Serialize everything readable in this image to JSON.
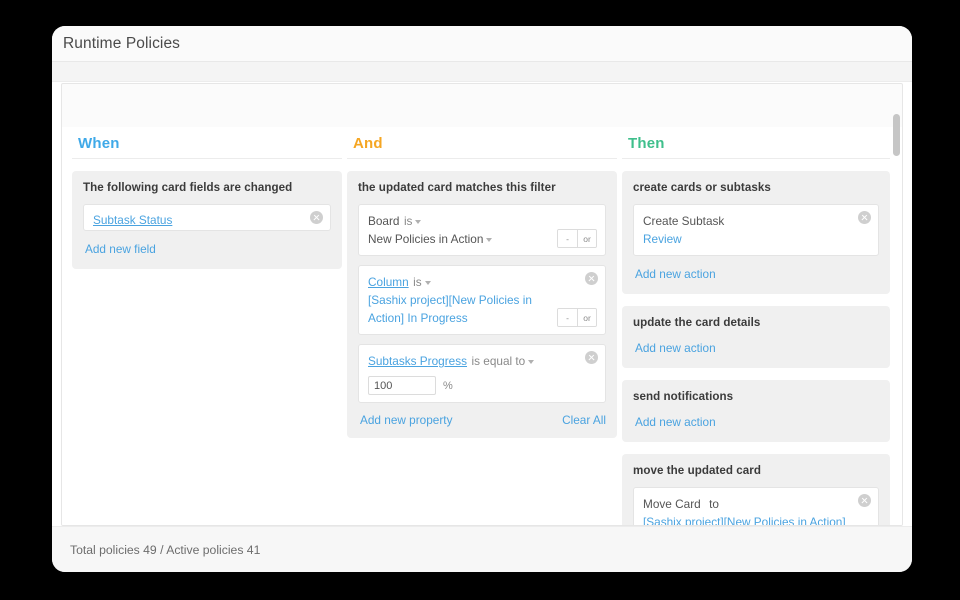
{
  "window": {
    "title": "Runtime Policies"
  },
  "colors": {
    "when": "#3fa9e8",
    "and": "#f5a623",
    "then": "#3fbf8c",
    "link": "#4aa3e0",
    "muted": "#8a8a8a"
  },
  "columns": {
    "when": {
      "header": "When",
      "groups": [
        {
          "title": "The following card fields are changed",
          "field_value": "Subtask Status",
          "add_label": "Add new field"
        }
      ]
    },
    "and": {
      "header": "And",
      "group_title": "the updated card matches this filter",
      "filters": [
        {
          "property": "Board",
          "property_is_link": false,
          "operator": "is",
          "value": "New Policies in Action",
          "value_has_caret": true,
          "has_close": false,
          "oper_minus": "-",
          "oper_or": "or"
        },
        {
          "property": "Column",
          "property_is_link": true,
          "operator": "is",
          "value": "[Sashix project][New Policies in Action] In Progress",
          "value_has_caret": false,
          "has_close": true,
          "oper_minus": "-",
          "oper_or": "or"
        },
        {
          "property": "Subtasks Progress",
          "property_is_link": true,
          "operator": "is equal to",
          "value": "100",
          "unit": "%",
          "has_close": true
        }
      ],
      "add_property_label": "Add new property",
      "clear_all_label": "Clear All"
    },
    "then": {
      "header": "Then",
      "groups": [
        {
          "title": "create cards or subtasks",
          "action": {
            "label": "Create Subtask",
            "value": "Review",
            "has_close": true
          },
          "add_label": "Add new action"
        },
        {
          "title": "update the card details",
          "add_label": "Add new action"
        },
        {
          "title": "send notifications",
          "add_label": "Add new action"
        },
        {
          "title": "move the updated card",
          "action": {
            "label": "Move Card",
            "preposition": "to",
            "value": "[Sashix project][New Policies in Action] Done | New features",
            "has_close": true
          }
        }
      ]
    }
  },
  "status": {
    "text": "Total policies 49 / Active policies 41"
  }
}
